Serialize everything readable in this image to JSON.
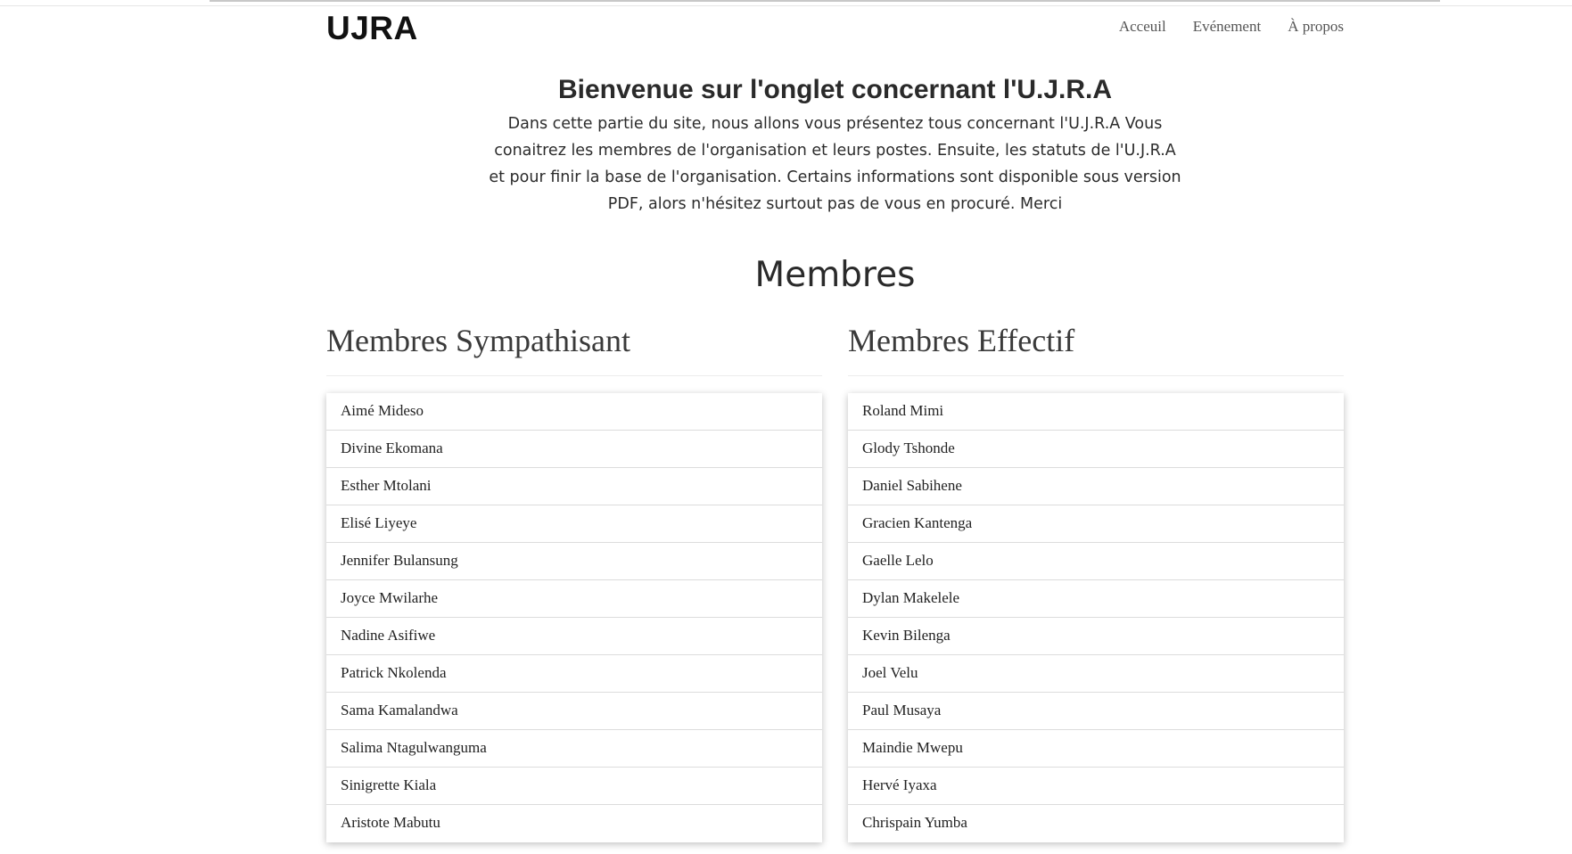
{
  "header": {
    "brand": "UJRA",
    "nav": [
      "Acceuil",
      "Evénement",
      "À propos"
    ]
  },
  "intro": {
    "title": "Bienvenue sur l'onglet concernant l'U.J.R.A",
    "text": "Dans cette partie du site, nous allons vous présentez tous concernant l'U.J.R.A Vous conaitrez les membres de l'organisation et leurs postes. Ensuite, les statuts de l'U.J.R.A et pour finir la base de l'organisation. Certains informations sont disponible sous version PDF, alors n'hésitez surtout pas de vous en procuré. Merci"
  },
  "members": {
    "title": "Membres",
    "sympathisant": {
      "title": "Membres Sympathisant",
      "items": [
        "Aimé Mideso",
        "Divine Ekomana",
        "Esther Mtolani",
        "Elisé Liyeye",
        "Jennifer Bulansung",
        "Joyce Mwilarhe",
        "Nadine Asifiwe",
        "Patrick Nkolenda",
        "Sama Kamalandwa",
        "Salima Ntagulwanguma",
        "Sinigrette Kiala",
        "Aristote Mabutu"
      ]
    },
    "effectif": {
      "title": "Membres Effectif",
      "items": [
        "Roland Mimi",
        "Glody Tshonde",
        "Daniel Sabihene",
        "Gracien Kantenga",
        "Gaelle Lelo",
        "Dylan Makelele",
        "Kevin Bilenga",
        "Joel Velu",
        "Paul Musaya",
        "Maindie Mwepu",
        "Hervé Iyaxa",
        "Chrispain Yumba"
      ]
    }
  }
}
